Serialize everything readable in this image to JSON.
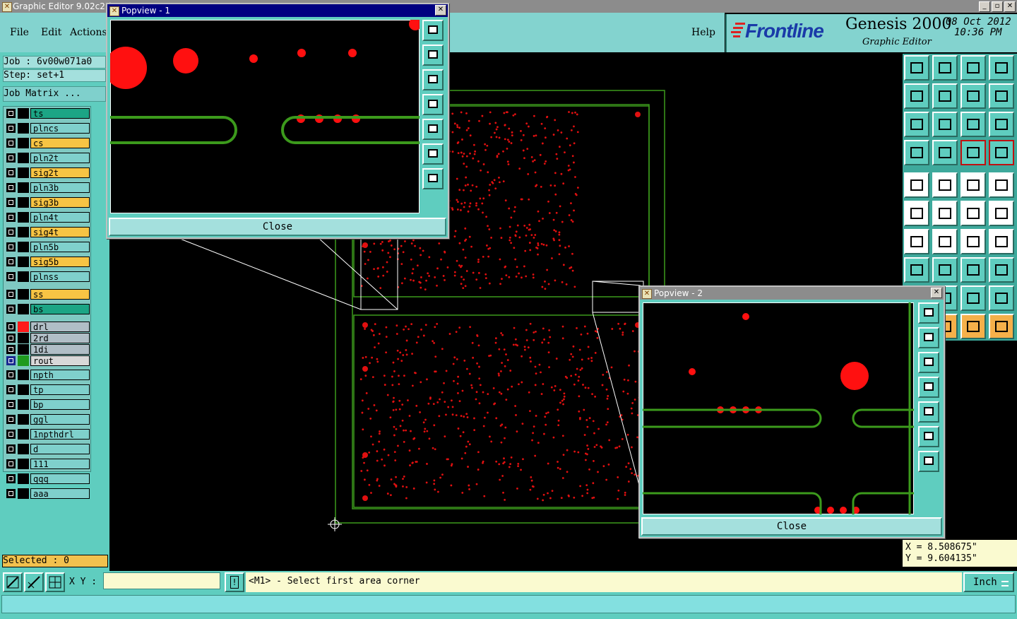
{
  "app": {
    "window_title": "Graphic Editor 9.02c2 (",
    "menus": [
      "File",
      "Edit",
      "Actions",
      "Help"
    ],
    "brand_logo": "Frontline",
    "brand_product": "Genesis 2000",
    "brand_sub": "Graphic Editor",
    "date": "08 Oct 2012",
    "time": "10:36 PM"
  },
  "job": {
    "job_label": "Job : 6v00w071a0",
    "step_label": "Step: set+1",
    "matrix_button": "Job Matrix ..."
  },
  "layers": [
    {
      "name": "ts",
      "color": "#1ca585"
    },
    {
      "name": "plncs",
      "color": "#7fd0cc"
    },
    {
      "name": "cs",
      "color": "#f7c444"
    },
    {
      "name": "pln2t",
      "color": "#7fd0cc"
    },
    {
      "name": "sig2t",
      "color": "#f7c444"
    },
    {
      "name": "pln3b",
      "color": "#7fd0cc"
    },
    {
      "name": "sig3b",
      "color": "#f7c444"
    },
    {
      "name": "pln4t",
      "color": "#7fd0cc"
    },
    {
      "name": "sig4t",
      "color": "#f7c444"
    },
    {
      "name": "pln5b",
      "color": "#7fd0cc"
    },
    {
      "name": "sig5b",
      "color": "#f7c444"
    },
    {
      "name": "plnss",
      "color": "#7fd0cc"
    },
    {
      "name": "ss",
      "color": "#f7c444"
    },
    {
      "name": "bs",
      "color": "#1ca585"
    },
    {
      "name": "drl",
      "color": "#b0bec6",
      "swatch": "#ff1a1a"
    },
    {
      "name": "2rd",
      "color": "#b0bec6"
    },
    {
      "name": "1di",
      "color": "#b0bec6"
    },
    {
      "name": "rout",
      "color": "#d8d8d8",
      "swatch": "#1f9a1f",
      "active": true
    },
    {
      "name": "npth",
      "color": "#7fd0cc"
    },
    {
      "name": "tp",
      "color": "#7fd0cc"
    },
    {
      "name": "bp",
      "color": "#7fd0cc"
    },
    {
      "name": "ggl",
      "color": "#7fd0cc"
    },
    {
      "name": "1npthdrl",
      "color": "#7fd0cc"
    },
    {
      "name": "d",
      "color": "#7fd0cc"
    },
    {
      "name": "111",
      "color": "#7fd0cc"
    },
    {
      "name": "qqq",
      "color": "#7fd0cc"
    },
    {
      "name": "aaa",
      "color": "#7fd0cc"
    }
  ],
  "selected_label": "Selected : 0",
  "popview1": {
    "title": "Popview - 1",
    "close": "Close"
  },
  "popview2": {
    "title": "Popview - 2",
    "close": "Close"
  },
  "coords": {
    "x": "X = 8.508675\"",
    "y": "Y = 9.604135\""
  },
  "statusbar": {
    "xy_label": "X Y :",
    "xy_value": "",
    "message": "<M1> - Select first area corner",
    "units": "Inch"
  },
  "colors": {
    "teal": "#5fcdbf",
    "pad_red": "#ff1010",
    "rout_green": "#3c9a1c"
  }
}
